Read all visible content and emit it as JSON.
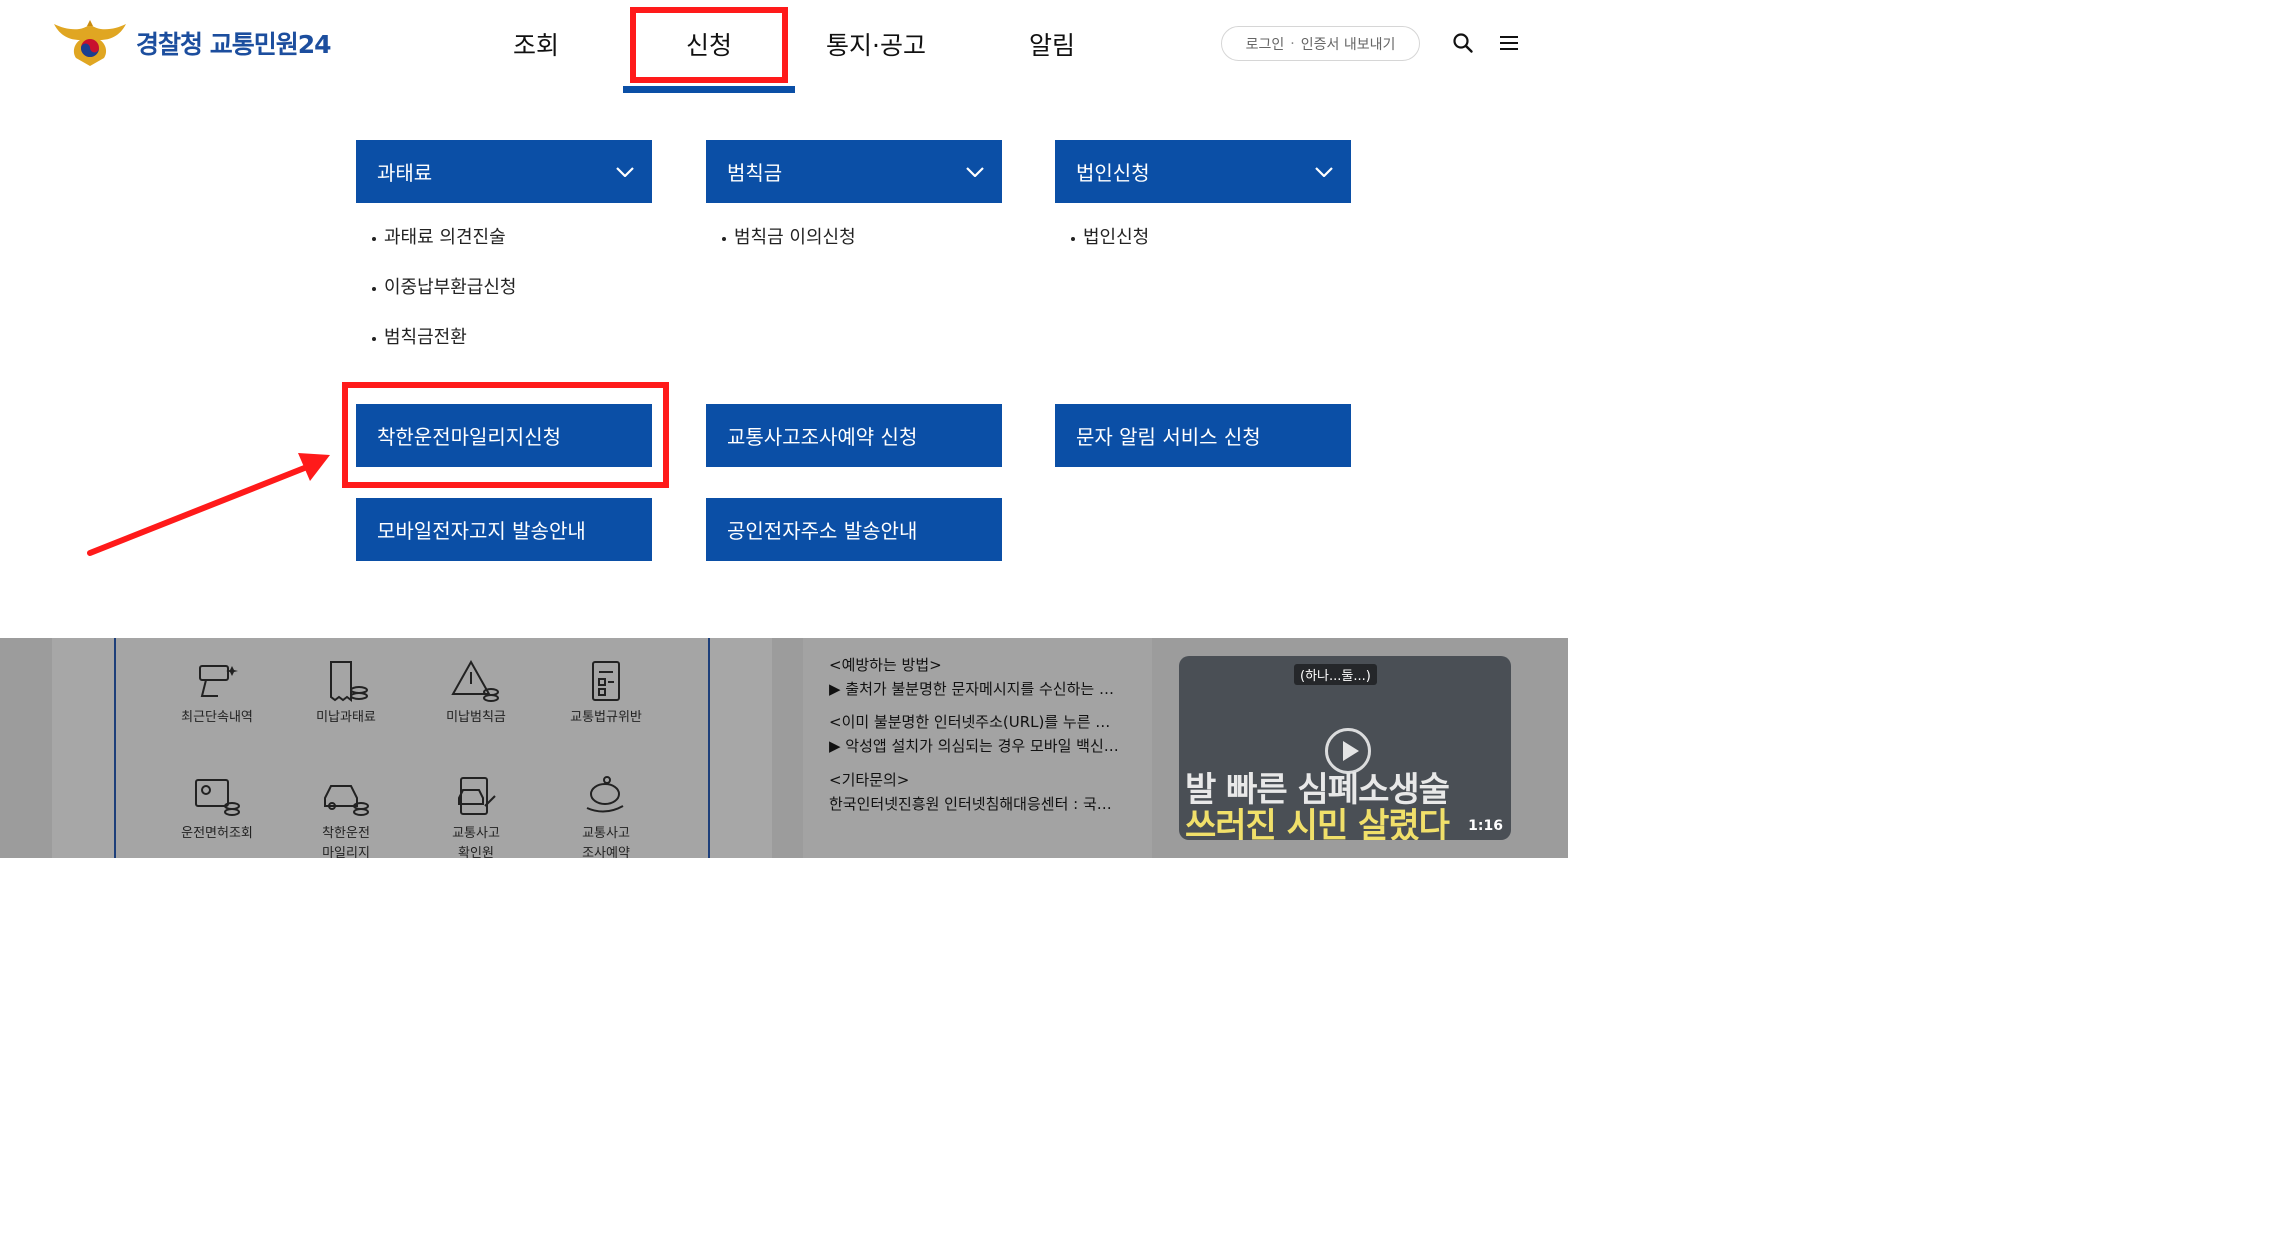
{
  "header": {
    "brand": "경찰청 교통민원24",
    "nav": [
      "조회",
      "신청",
      "통지·공고",
      "알림"
    ],
    "login": "로그인",
    "cert_export": "인증서 내보내기",
    "icons": [
      "search-icon",
      "menu-icon"
    ]
  },
  "submenu": {
    "groups": [
      {
        "title": "과태료",
        "items": [
          "과태료 의견진술",
          "이중납부환급신청",
          "범칙금전환"
        ]
      },
      {
        "title": "범칙금",
        "items": [
          "범칙금 이의신청"
        ]
      },
      {
        "title": "법인신청",
        "items": [
          "법인신청"
        ]
      }
    ],
    "tiles": [
      "착한운전마일리지신청",
      "교통사고조사예약 신청",
      "문자 알림 서비스 신청",
      "모바일전자고지 발송안내",
      "공인전자주소 발송안내"
    ]
  },
  "background": {
    "quick_links": [
      "최근단속내역",
      "미납과태료",
      "미납범칙금",
      "교통법규위반",
      "운전면허조회",
      "착한운전\n마일리지",
      "교통사고\n확인원",
      "교통사고\n조사예약"
    ],
    "news": [
      "<예방하는 방법>",
      "▶ 출처가 불분명한 문자메시지를 수신하는 …",
      "<이미 불분명한 인터넷주소(URL)를 누른 …",
      "▶ 악성앱 설치가 의심되는 경우 모바일 백신…",
      "<기타문의>",
      "한국인터넷진흥원 인터넷침해대응센터 : 국…"
    ],
    "video": {
      "tag": "(하나...둘...)",
      "caption_line1": "발 빠른 심폐소생술",
      "caption_line2": "쓰러진 시민 살렸다",
      "duration": "1:16"
    }
  },
  "colors": {
    "brand_blue": "#0b4fa6",
    "highlight_red": "#ff1a1a",
    "dim_overlay": "#9c9c9c"
  }
}
